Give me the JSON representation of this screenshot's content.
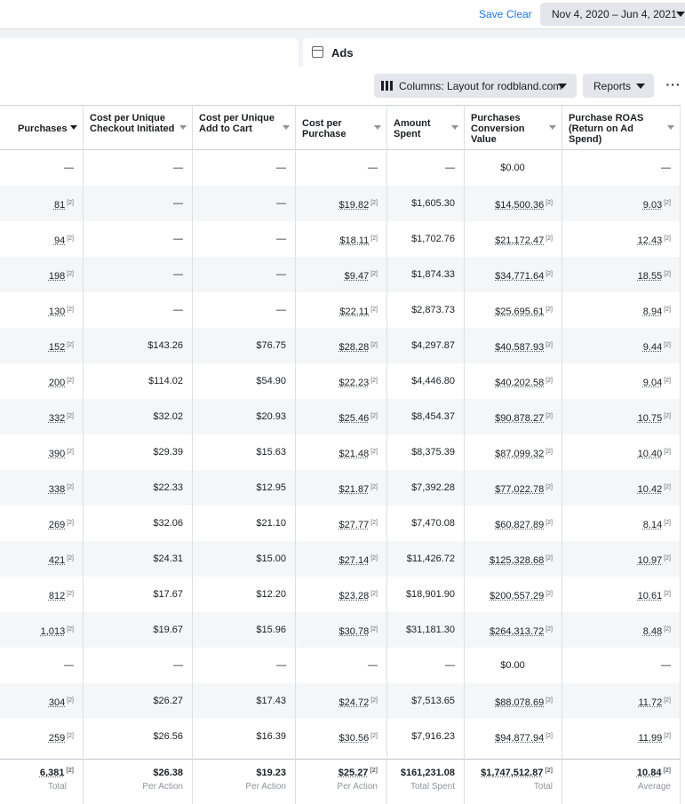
{
  "header": {
    "save_label": "Save",
    "clear_label": "Clear",
    "date_range": "Nov 4, 2020 – Jun 4, 2021"
  },
  "tabs": {
    "ads_label": "Ads",
    "ads_icon": "ads-panel-icon"
  },
  "toolbar": {
    "columns_label": "Columns: Layout for rodbland.com",
    "columns_icon": "columns-icon",
    "reports_label": "Reports",
    "more_label": "···"
  },
  "table": {
    "columns": [
      {
        "key": "purchases",
        "label": "Purchases"
      },
      {
        "key": "cpu_checkout",
        "label": "Cost per Unique Checkout Initiated"
      },
      {
        "key": "cpu_add_to_cart",
        "label": "Cost per Unique Add to Cart"
      },
      {
        "key": "cost_per_purchase",
        "label": "Cost per Purchase"
      },
      {
        "key": "amount_spent",
        "label": "Amount Spent"
      },
      {
        "key": "conversion_value",
        "label": "Purchases Conversion Value"
      },
      {
        "key": "roas",
        "label": "Purchase ROAS (Return on Ad Spend)"
      }
    ],
    "sup_marker": "[2]",
    "rows": [
      [
        "—",
        "—",
        "—",
        "—",
        "—",
        "$0.00",
        "—"
      ],
      [
        "81",
        "—",
        "—",
        "$19.82",
        "$1,605.30",
        "$14,500.36",
        "9.03"
      ],
      [
        "94",
        "—",
        "—",
        "$18.11",
        "$1,702.76",
        "$21,172.47",
        "12.43"
      ],
      [
        "198",
        "—",
        "—",
        "$9.47",
        "$1,874.33",
        "$34,771.64",
        "18.55"
      ],
      [
        "130",
        "—",
        "—",
        "$22.11",
        "$2,873.73",
        "$25,695.61",
        "8.94"
      ],
      [
        "152",
        "$143.26",
        "$76.75",
        "$28.28",
        "$4,297.87",
        "$40,587.93",
        "9.44"
      ],
      [
        "200",
        "$114.02",
        "$54.90",
        "$22.23",
        "$4,446.80",
        "$40,202.58",
        "9.04"
      ],
      [
        "332",
        "$32.02",
        "$20.93",
        "$25.46",
        "$8,454.37",
        "$90,878.27",
        "10.75"
      ],
      [
        "390",
        "$29.39",
        "$15.63",
        "$21.48",
        "$8,375.39",
        "$87,099.32",
        "10.40"
      ],
      [
        "338",
        "$22.33",
        "$12.95",
        "$21.87",
        "$7,392.28",
        "$77,022.78",
        "10.42"
      ],
      [
        "269",
        "$32.06",
        "$21.10",
        "$27.77",
        "$7,470.08",
        "$60,827.89",
        "8.14"
      ],
      [
        "421",
        "$24.31",
        "$15.00",
        "$27.14",
        "$11,426.72",
        "$125,328.68",
        "10.97"
      ],
      [
        "812",
        "$17.67",
        "$12.20",
        "$23.28",
        "$18,901.90",
        "$200,557.29",
        "10.61"
      ],
      [
        "1,013",
        "$19.67",
        "$15.96",
        "$30.78",
        "$31,181.30",
        "$264,313.72",
        "8.48"
      ],
      [
        "—",
        "—",
        "—",
        "—",
        "—",
        "$0.00",
        "—"
      ],
      [
        "304",
        "$26.27",
        "$17.43",
        "$24.72",
        "$7,513.65",
        "$88,078.69",
        "11.72"
      ],
      [
        "259",
        "$26.56",
        "$16.39",
        "$30.56",
        "$7,916.23",
        "$94,877.94",
        "11.99"
      ]
    ],
    "totals": [
      {
        "value": "6,381",
        "label": "Total"
      },
      {
        "value": "$26.38",
        "label": "Per Action"
      },
      {
        "value": "$19.23",
        "label": "Per Action"
      },
      {
        "value": "$25.27",
        "label": "Per Action"
      },
      {
        "value": "$161,231.08",
        "label": "Total Spent"
      },
      {
        "value": "$1,747,512.87",
        "label": "Total"
      },
      {
        "value": "10.84",
        "label": "Average"
      }
    ]
  },
  "colors": {
    "accent": "#1877f2",
    "row_alt": "#f5f6f7",
    "button_bg": "#e4e6eb"
  }
}
